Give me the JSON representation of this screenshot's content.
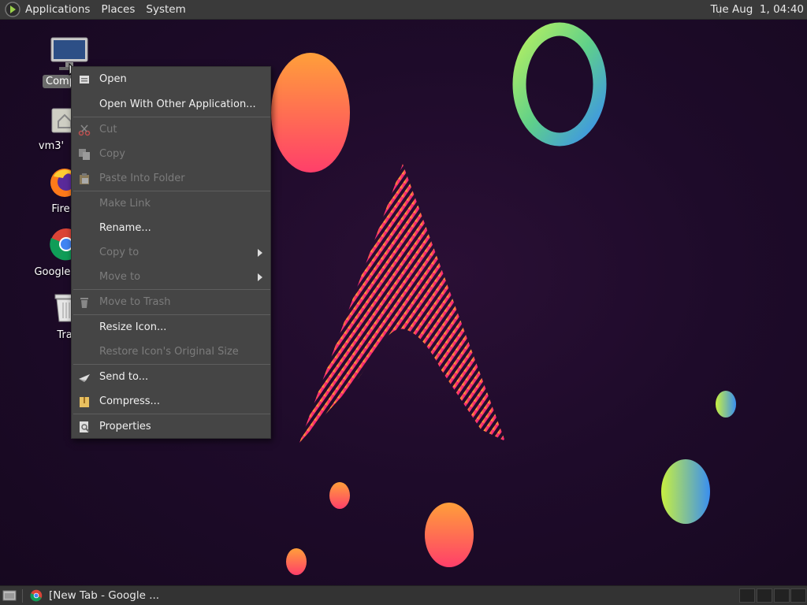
{
  "top_panel": {
    "menus": [
      "Applications",
      "Places",
      "System"
    ],
    "clock": "Tue Aug  1, 04:40"
  },
  "desktop_icons": [
    {
      "label": "Comp",
      "icon": "computer-icon"
    },
    {
      "label": "vm3'",
      "icon": "home-folder-icon"
    },
    {
      "label": "Fire",
      "icon": "firefox-icon"
    },
    {
      "label": "Google C",
      "icon": "chrome-icon"
    },
    {
      "label": "Tra",
      "icon": "trash-icon"
    }
  ],
  "context_menu": {
    "items": [
      {
        "label": "Open",
        "enabled": true,
        "icon": "open-icon"
      },
      {
        "label": "Open With Other Application...",
        "enabled": true
      },
      {
        "label": "Cut",
        "enabled": false,
        "icon": "scissors-icon"
      },
      {
        "label": "Copy",
        "enabled": false,
        "icon": "copy-icon"
      },
      {
        "label": "Paste Into Folder",
        "enabled": false,
        "icon": "paste-icon"
      },
      {
        "label": "Make Link",
        "enabled": false
      },
      {
        "label": "Rename...",
        "enabled": true
      },
      {
        "label": "Copy to",
        "enabled": false,
        "submenu": true
      },
      {
        "label": "Move to",
        "enabled": false,
        "submenu": true
      },
      {
        "label": "Move to Trash",
        "enabled": false,
        "icon": "trash-icon"
      },
      {
        "label": "Resize Icon...",
        "enabled": true
      },
      {
        "label": "Restore Icon's Original Size",
        "enabled": false
      },
      {
        "label": "Send to...",
        "enabled": true,
        "icon": "send-icon"
      },
      {
        "label": "Compress...",
        "enabled": true,
        "icon": "archive-icon"
      },
      {
        "label": "Properties",
        "enabled": true,
        "icon": "properties-icon"
      }
    ]
  },
  "taskbar": {
    "window_label": "[New Tab - Google ..."
  },
  "colors": {
    "panel": "#3a3a3a",
    "menu_bg": "#454545",
    "menu_text": "#f0f0f0",
    "menu_disabled": "#7c7c7c"
  }
}
